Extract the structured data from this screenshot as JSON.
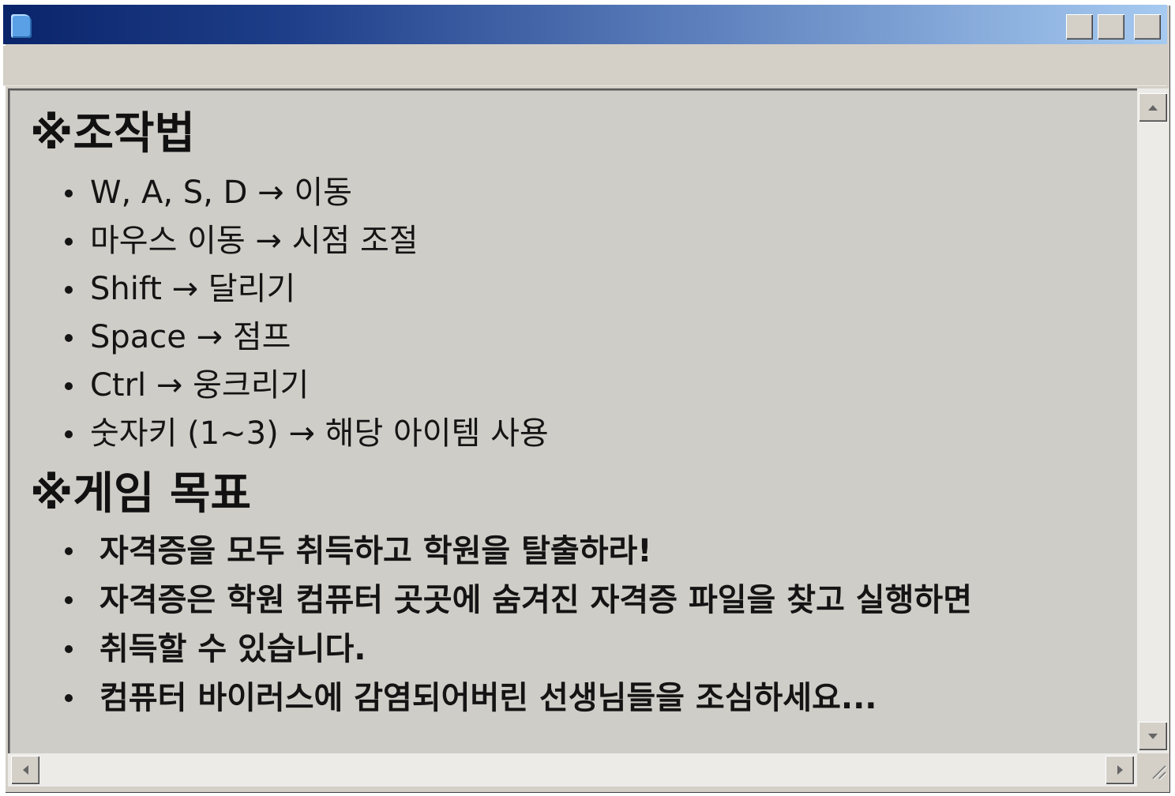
{
  "window": {
    "title_icon": "notepad-document-icon"
  },
  "controls": {
    "heading": "※조작법",
    "items": [
      "W, A, S, D → 이동",
      "마우스 이동 → 시점 조절",
      "Shift → 달리기",
      "Space → 점프",
      "Ctrl → 웅크리기",
      "숫자키 (1~3) → 해당 아이템 사용"
    ]
  },
  "goals": {
    "heading": "※게임 목표",
    "items": [
      "자격증을 모두 취득하고 학원을 탈출하라!",
      "자격증은 학원 컴퓨터 곳곳에 숨겨진 자격증 파일을 찾고 실행하면",
      "취득할 수 있습니다.",
      "컴퓨터 바이러스에 감염되어버린 선생님들을 조심하세요..."
    ]
  },
  "colors": {
    "titlebar_start": "#0a246a",
    "titlebar_end": "#a6caf0",
    "window_face": "#d4d0c8",
    "text": "#141414"
  }
}
